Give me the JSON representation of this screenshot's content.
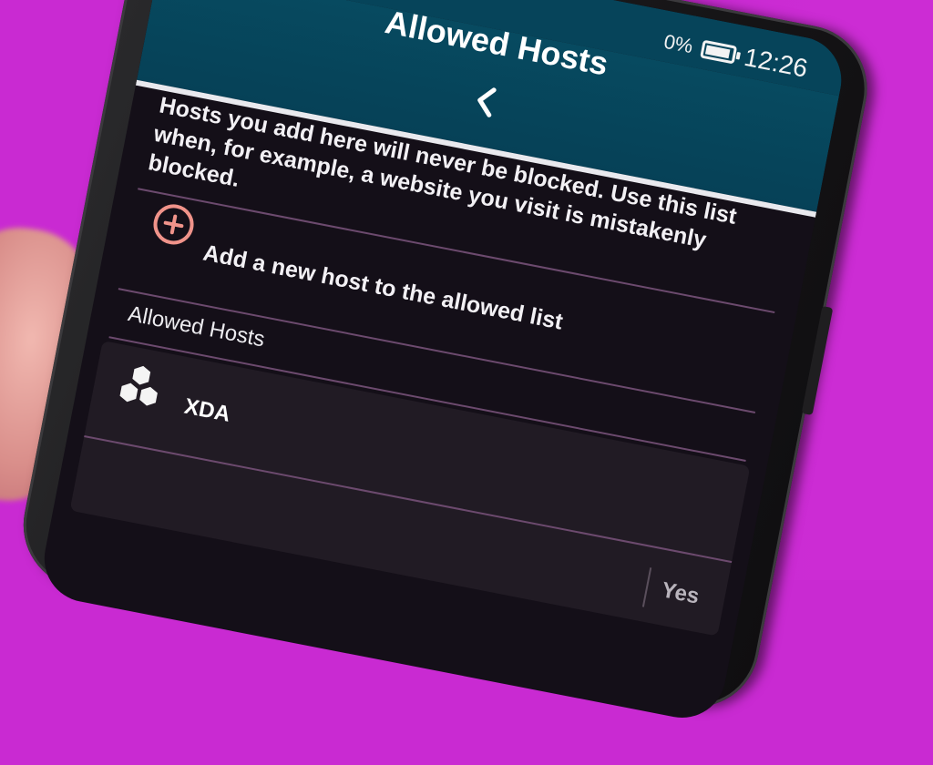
{
  "status_bar": {
    "battery_percent_fragment": "0%",
    "time": "12:26"
  },
  "app_bar": {
    "title": "Allowed Hosts"
  },
  "description": "Hosts you add here will never be blocked. Use this list when, for example, a website you visit is mistakenly blocked.",
  "add_host": {
    "label": "Add a new host to the allowed list"
  },
  "allowed_section": {
    "title": "Allowed Hosts",
    "hosts": [
      {
        "name": "XDA",
        "enabled_label": "Yes",
        "icon": "hexagon-cluster-icon"
      }
    ]
  },
  "colors": {
    "background": "#c92ad2",
    "app_bar": "#064a60",
    "screen": "#140f18",
    "accent": "#f0938a",
    "divider": "#6c4a6e"
  }
}
